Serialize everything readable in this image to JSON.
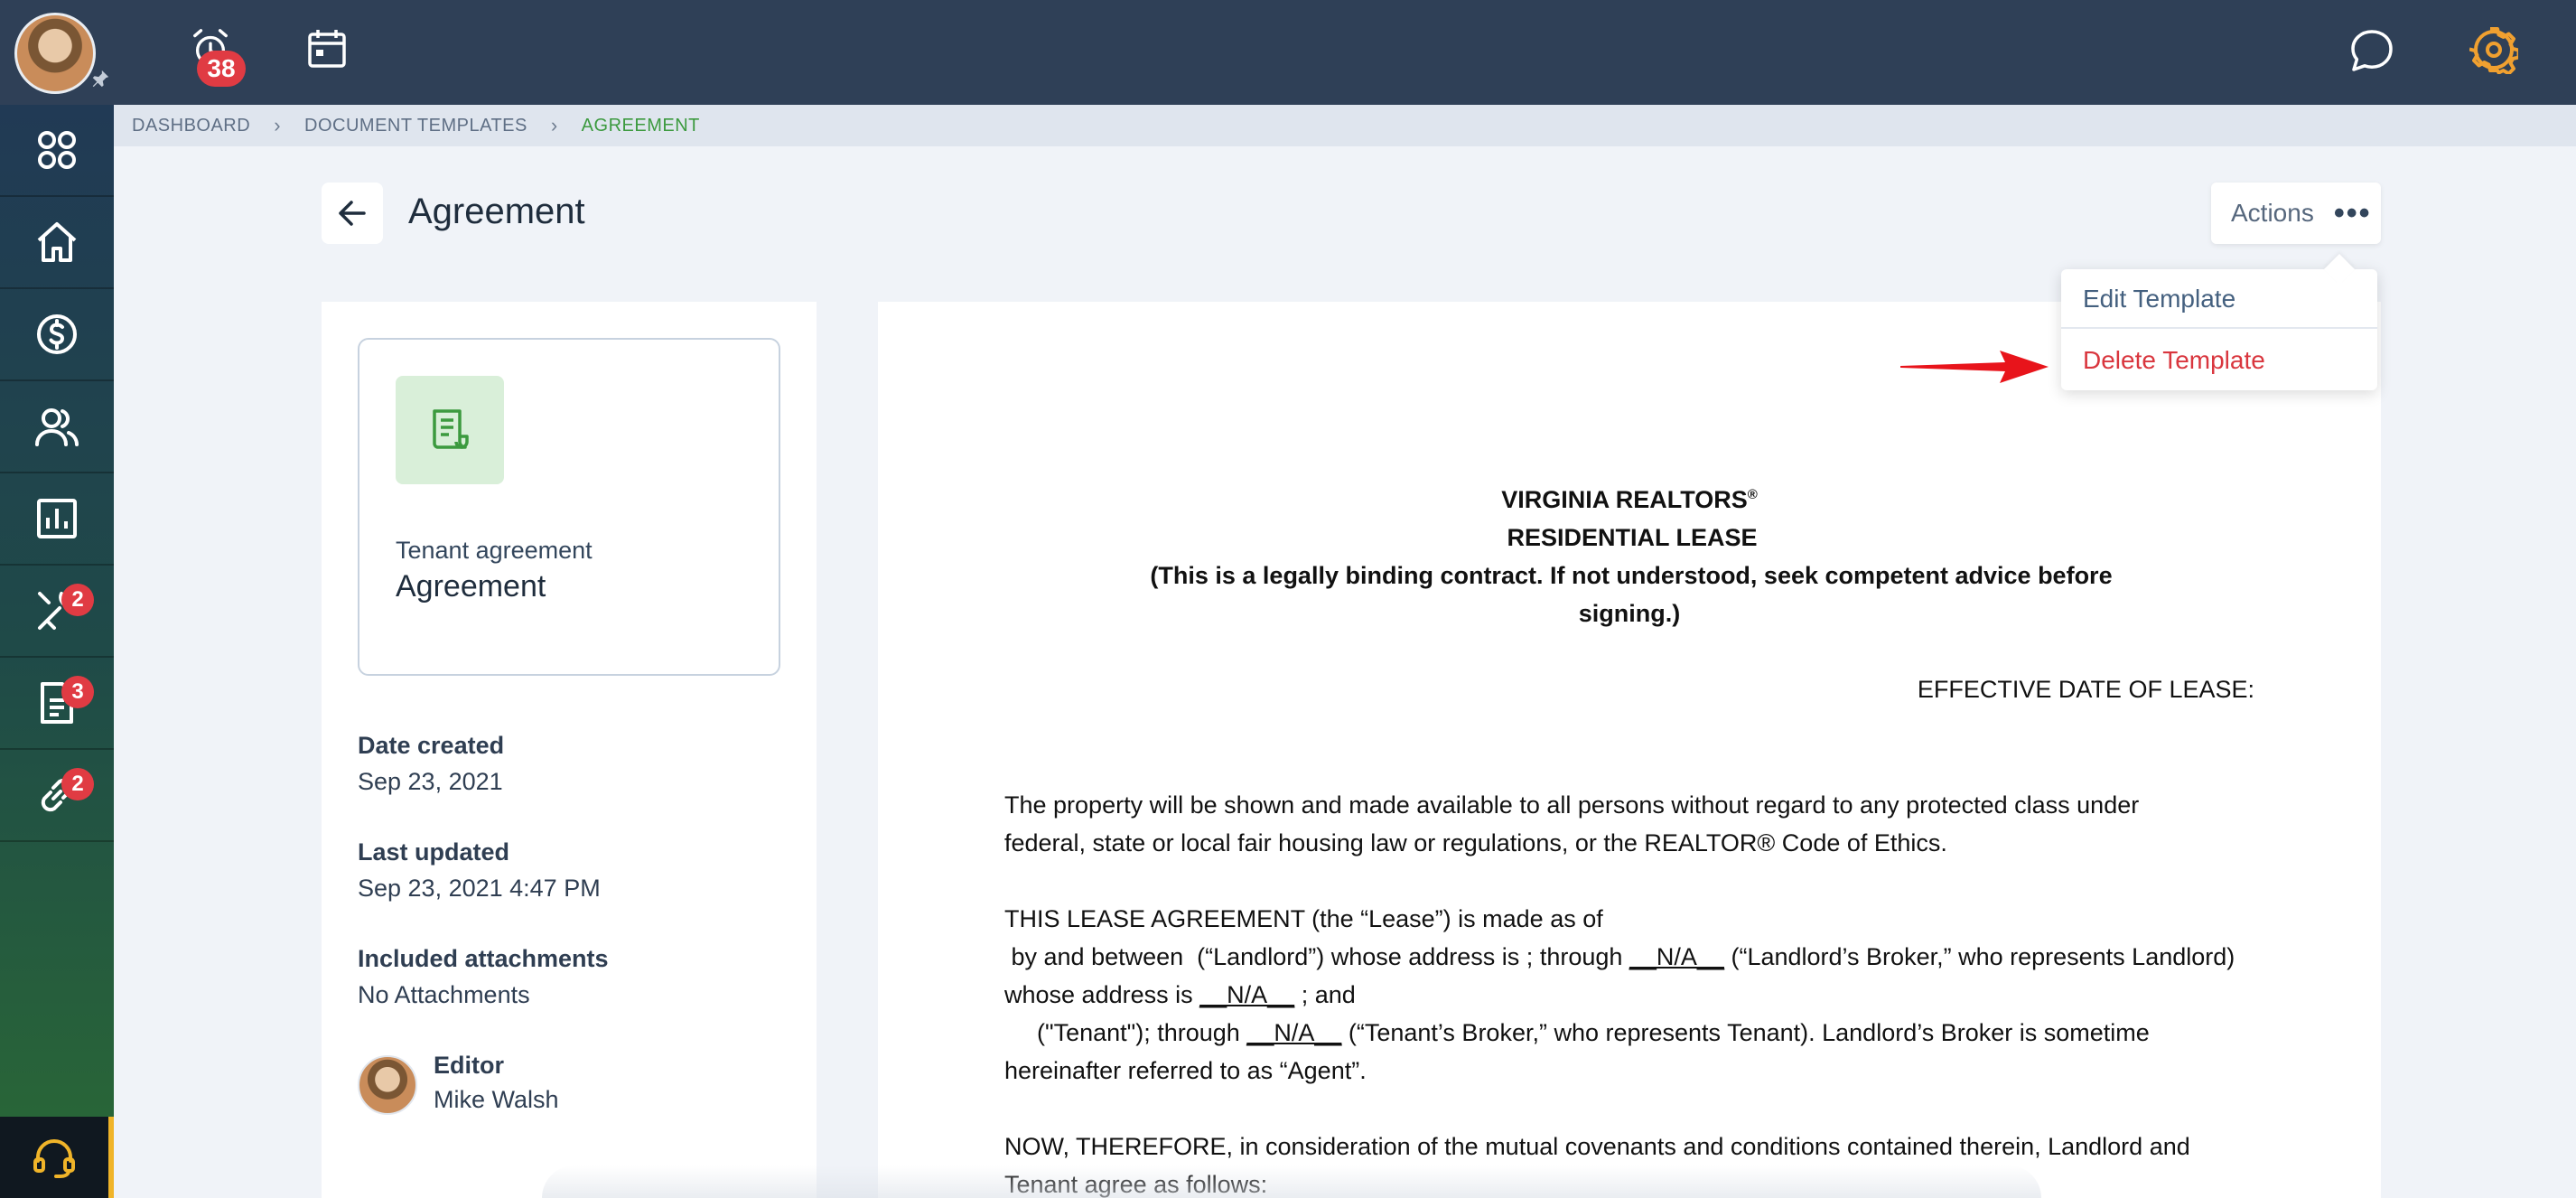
{
  "topbar": {
    "alarm_count": "38"
  },
  "sidebar": {
    "maintenance_badge": "2",
    "documents_badge": "3",
    "links_badge": "2"
  },
  "breadcrumb": {
    "items": [
      "DASHBOARD",
      "DOCUMENT TEMPLATES",
      "AGREEMENT"
    ]
  },
  "header": {
    "title": "Agreement",
    "actions_label": "Actions"
  },
  "menu": {
    "edit": "Edit Template",
    "delete": "Delete Template"
  },
  "template": {
    "subtitle": "Tenant agreement",
    "name": "Agreement",
    "date_created_label": "Date created",
    "date_created": "Sep 23, 2021",
    "last_updated_label": "Last updated",
    "last_updated": "Sep 23, 2021 4:47 PM",
    "attachments_label": "Included attachments",
    "attachments": "No Attachments",
    "editor_label": "Editor",
    "editor_name": "Mike Walsh"
  },
  "document": {
    "title1": "VIRGINIA REALTORS",
    "reg": "®",
    "title2": "RESIDENTIAL LEASE",
    "title3": "(This is a legally binding contract. If not understood, seek competent advice before",
    "title4": "signing.)",
    "effective": "EFFECTIVE DATE OF LEASE:",
    "p1_line1": "The property will be shown and made available to all persons without regard to any protected class under",
    "p1_line2": "federal, state or  local fair housing law or regulations, or the REALTOR® Code of Ethics.",
    "p2_line1": "THIS LEASE AGREEMENT (the “Lease”) is made as of",
    "p2_line2a": " by and between  (“Landlord”) whose address is ; through ",
    "na": "__N/A__",
    "p2_line2b": " (“Landlord’s Broker,” who represents Landlord)",
    "p2_line3a": "whose address is ",
    "p2_line3b": " ; and",
    "p2_line4a": "(\"Tenant\"); through ",
    "p2_line4b": " (“Tenant’s Broker,” who represents Tenant). Landlord’s Broker is sometime",
    "p2_line5": "hereinafter referred to as “Agent”.",
    "p3_line1": "NOW, THEREFORE, in consideration of the mutual covenants and conditions contained therein, Landlord and",
    "p3_line2": "Tenant agree as follows:"
  }
}
